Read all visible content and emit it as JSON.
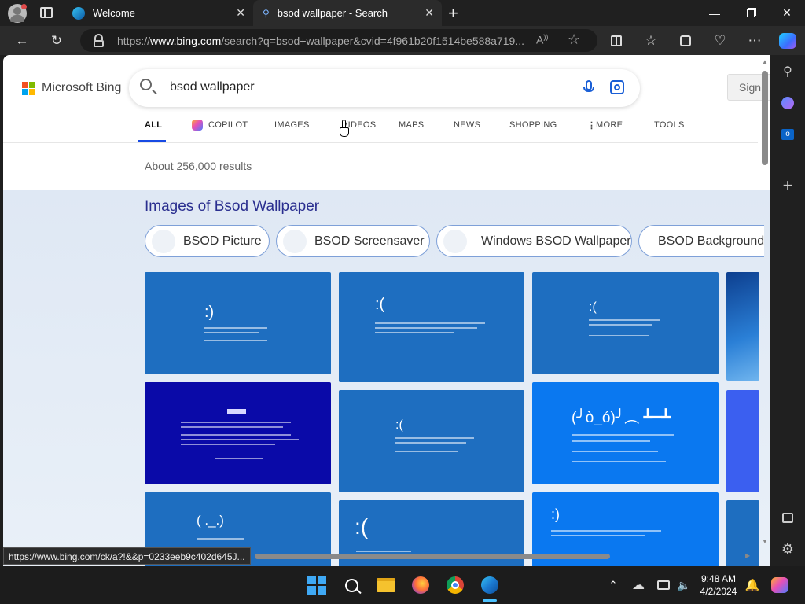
{
  "browser": {
    "tabs": [
      {
        "title": "Welcome"
      },
      {
        "title": "bsod wallpaper - Search"
      }
    ],
    "url": {
      "prefix": "https://",
      "host": "www.bing.com",
      "rest": "/search?q=bsod+wallpaper&cvid=4f961b20f1514be588a719..."
    }
  },
  "bing": {
    "logo_text": "Microsoft Bing",
    "query": "bsod wallpaper",
    "signin_label": "Sign",
    "nav": {
      "all": "ALL",
      "copilot": "COPILOT",
      "images": "IMAGES",
      "videos": "VIDEOS",
      "maps": "MAPS",
      "news": "NEWS",
      "shopping": "SHOPPING",
      "more": "MORE",
      "tools": "TOOLS"
    },
    "results_count": "About 256,000 results",
    "images_heading": "Images of Bsod Wallpaper",
    "chips": [
      "BSOD Picture",
      "BSOD Screensaver",
      "Windows BSOD Wallpaper",
      "BSOD Background"
    ]
  },
  "status_url": "https://www.bing.com/ck/a?!&&p=0233eeb9c402d645J...",
  "clock": {
    "time": "9:48 AM",
    "date": "4/2/2024"
  },
  "colors": {
    "bing_blue": "#174ae4",
    "bsod_blue": "#1f6fc0",
    "bsod_dark": "#0000aa"
  }
}
